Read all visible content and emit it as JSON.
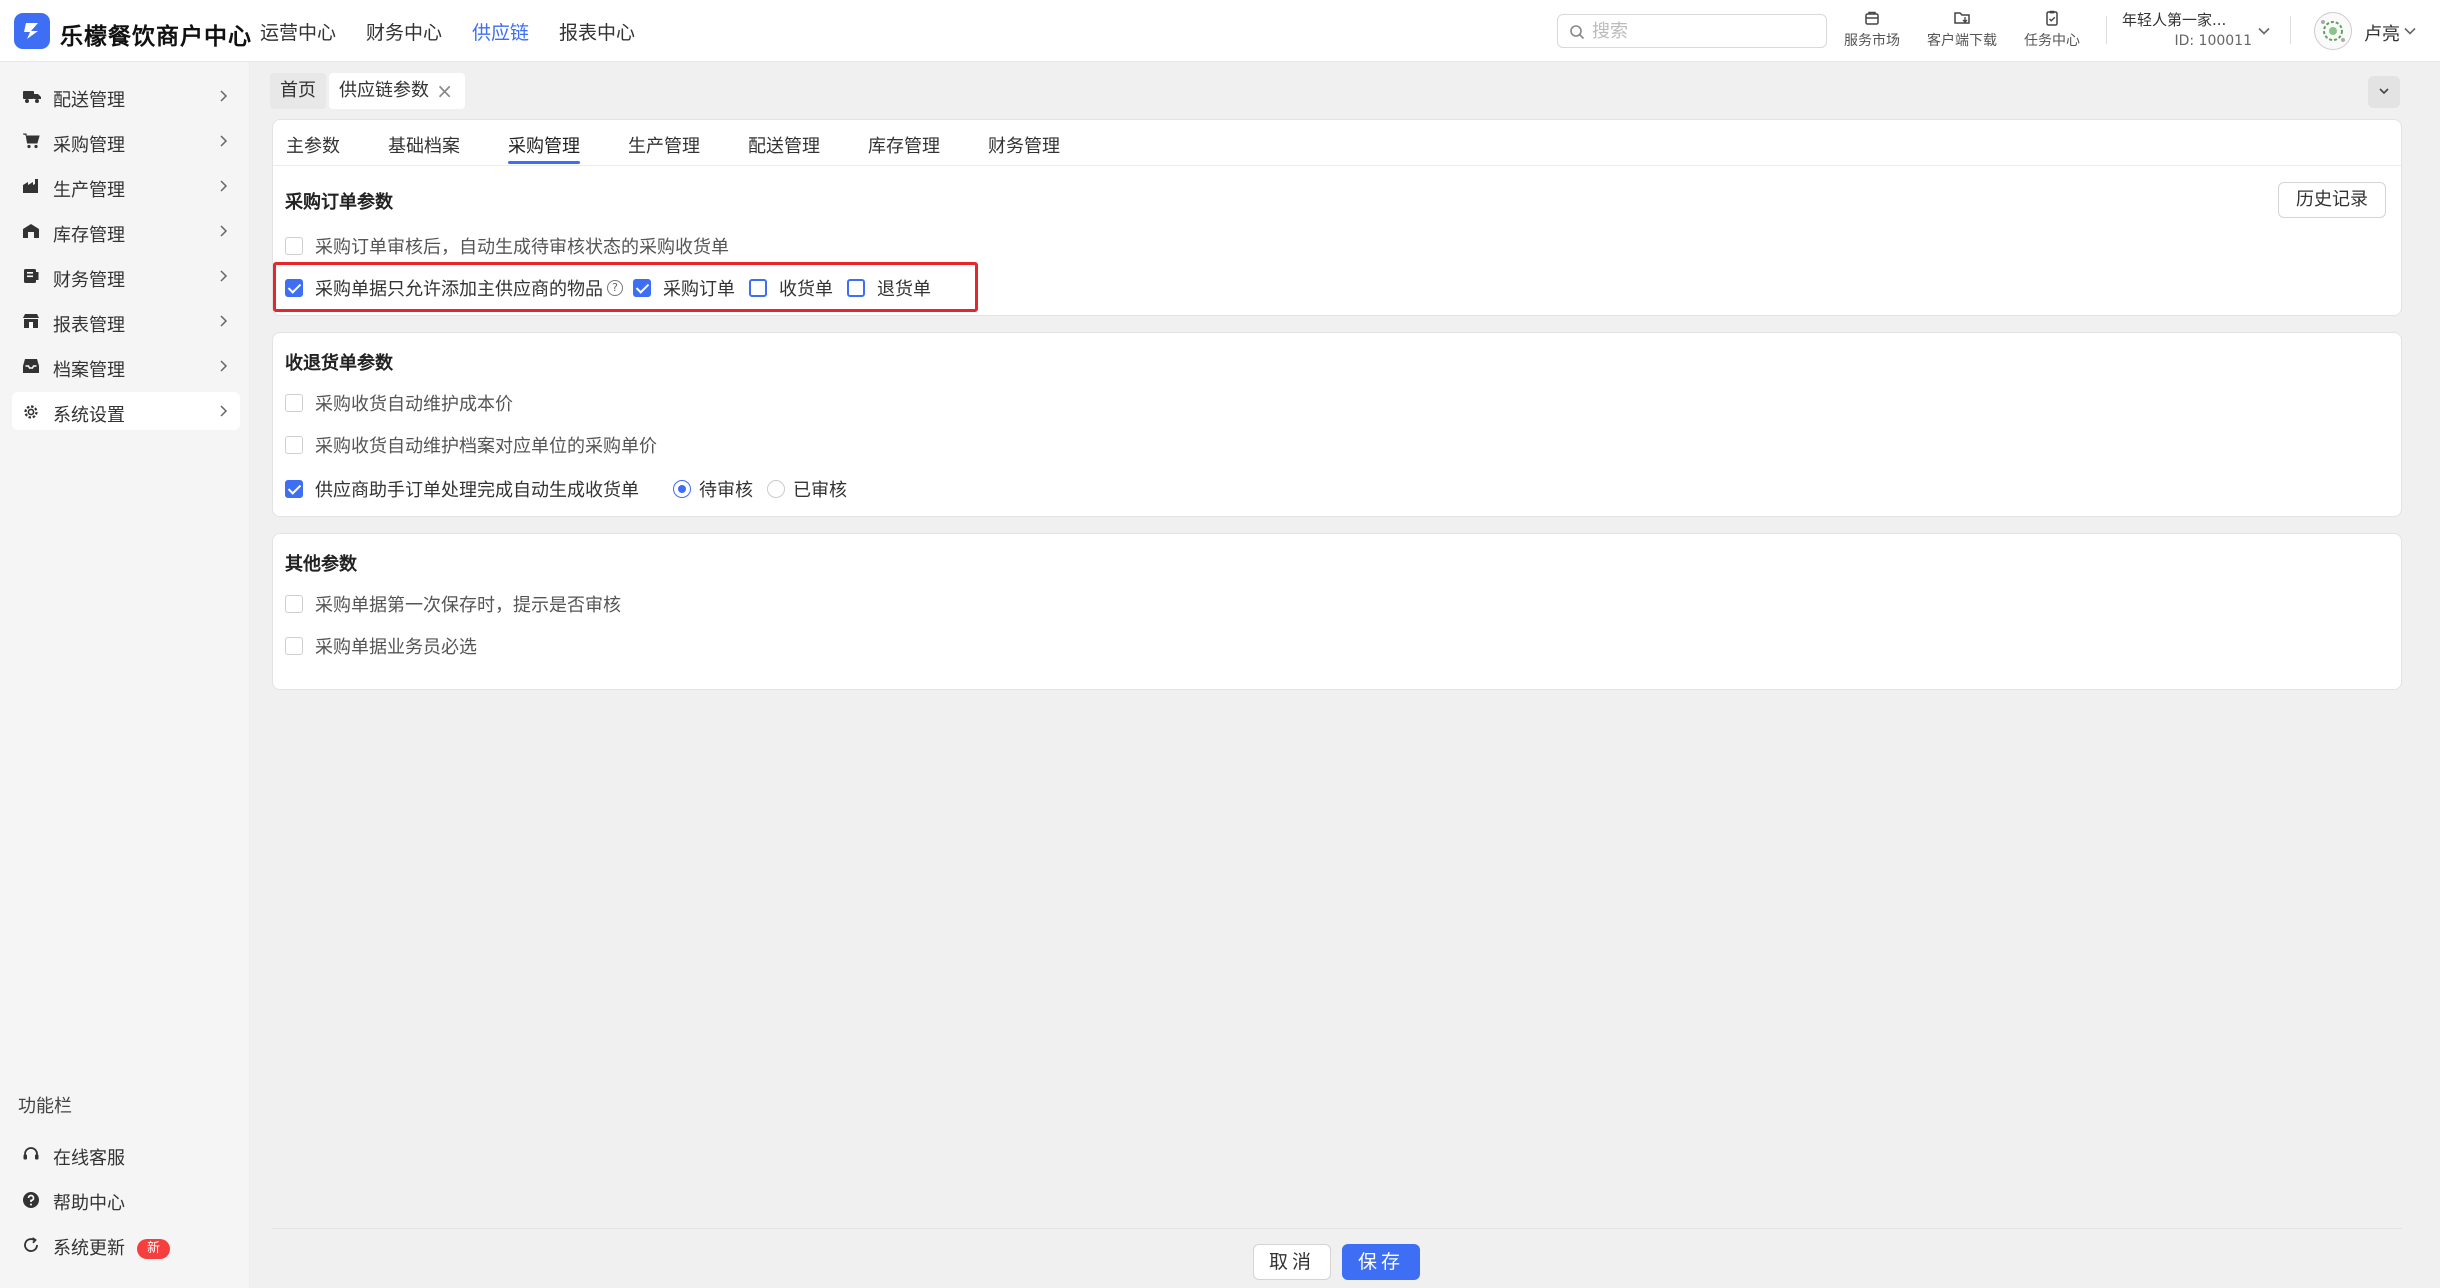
{
  "app": {
    "title": "乐檬餐饮商户中心"
  },
  "top_nav": [
    {
      "label": "运营中心",
      "active": false
    },
    {
      "label": "财务中心",
      "active": false
    },
    {
      "label": "供应链",
      "active": true
    },
    {
      "label": "报表中心",
      "active": false
    }
  ],
  "search": {
    "placeholder": "搜索",
    "value": ""
  },
  "tools": [
    {
      "label": "服务市场",
      "icon": "store-icon"
    },
    {
      "label": "客户端下载",
      "icon": "folder-download-icon"
    },
    {
      "label": "任务中心",
      "icon": "clipboard-icon"
    }
  ],
  "account": {
    "name": "年轻人第一家...",
    "id": "ID: 100011"
  },
  "user": {
    "name": "卢亮"
  },
  "sidebar": {
    "items": [
      {
        "label": "配送管理",
        "icon": "truck-icon"
      },
      {
        "label": "采购管理",
        "icon": "cart-icon"
      },
      {
        "label": "生产管理",
        "icon": "factory-icon"
      },
      {
        "label": "库存管理",
        "icon": "warehouse-icon"
      },
      {
        "label": "财务管理",
        "icon": "ledger-icon"
      },
      {
        "label": "报表管理",
        "icon": "report-icon"
      },
      {
        "label": "档案管理",
        "icon": "inbox-icon"
      },
      {
        "label": "系统设置",
        "icon": "gear-icon",
        "active": true
      }
    ],
    "footer_title": "功能栏",
    "footer_items": [
      {
        "label": "在线客服",
        "icon": "headset-icon"
      },
      {
        "label": "帮助中心",
        "icon": "help-icon"
      },
      {
        "label": "系统更新",
        "icon": "refresh-icon",
        "badge": "新"
      }
    ]
  },
  "page_tabs": {
    "home": "首页",
    "current": "供应链参数",
    "close": "×"
  },
  "tabs": [
    "主参数",
    "基础档案",
    "采购管理",
    "生产管理",
    "配送管理",
    "库存管理",
    "财务管理"
  ],
  "active_tab": "采购管理",
  "purchase_order": {
    "title": "采购订单参数",
    "history_button": "历史记录",
    "opt1": {
      "label": "采购订单审核后，自动生成待审核状态的采购收货单",
      "checked": false
    },
    "opt2": {
      "label": "采购单据只允许添加主供应商的物品",
      "checked": true
    },
    "opt2_help": "?",
    "opt2_sub": [
      {
        "label": "采购订单",
        "checked": true
      },
      {
        "label": "收货单",
        "checked": false
      },
      {
        "label": "退货单",
        "checked": false
      }
    ]
  },
  "receipt": {
    "title": "收退货单参数",
    "opt1": {
      "label": "采购收货自动维护成本价",
      "checked": false
    },
    "opt2": {
      "label": "采购收货自动维护档案对应单位的采购单价",
      "checked": false
    },
    "opt3": {
      "label": "供应商助手订单处理完成自动生成收货单",
      "checked": true
    },
    "radios": [
      {
        "label": "待审核",
        "selected": true
      },
      {
        "label": "已审核",
        "selected": false
      }
    ]
  },
  "other": {
    "title": "其他参数",
    "opt1": {
      "label": "采购单据第一次保存时，提示是否审核",
      "checked": false
    },
    "opt2": {
      "label": "采购单据业务员必选",
      "checked": false
    }
  },
  "footer": {
    "cancel": "取消",
    "save": "保存"
  },
  "colors": {
    "accent": "#3d6ef3",
    "highlight": "#e5262a",
    "badge": "#f53f3f"
  }
}
